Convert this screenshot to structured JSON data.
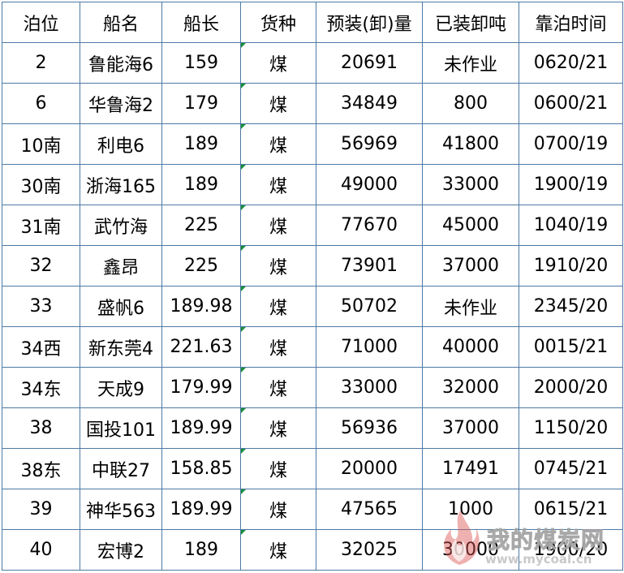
{
  "headers": [
    "泊位",
    "船名",
    "船长",
    "货种",
    "预装(卸)量",
    "已装卸吨",
    "靠泊时间"
  ],
  "rows": [
    [
      "2",
      "鲁能海6",
      "159",
      "煤",
      "20691",
      "未作业",
      "0620/21"
    ],
    [
      "6",
      "华鲁海2",
      "179",
      "煤",
      "34849",
      "800",
      "0600/21"
    ],
    [
      "10南",
      "利电6",
      "189",
      "煤",
      "56969",
      "41800",
      "0700/19"
    ],
    [
      "30南",
      "浙海165",
      "189",
      "煤",
      "49000",
      "33000",
      "1900/19"
    ],
    [
      "31南",
      "武竹海",
      "225",
      "煤",
      "77670",
      "45000",
      "1040/19"
    ],
    [
      "32",
      "鑫昂",
      "225",
      "煤",
      "73901",
      "37000",
      "1910/20"
    ],
    [
      "33",
      "盛帆6",
      "189.98",
      "煤",
      "50702",
      "未作业",
      "2345/20"
    ],
    [
      "34西",
      "新东莞4",
      "221.63",
      "煤",
      "71000",
      "40000",
      "0015/21"
    ],
    [
      "34东",
      "天成9",
      "179.99",
      "煤",
      "33000",
      "32000",
      "2000/20"
    ],
    [
      "38",
      "国投101",
      "189.99",
      "煤",
      "56936",
      "37000",
      "1150/20"
    ],
    [
      "38东",
      "中联27",
      "158.85",
      "煤",
      "20000",
      "17491",
      "0745/21"
    ],
    [
      "39",
      "神华563",
      "189.99",
      "煤",
      "47565",
      "1000",
      "0615/21"
    ],
    [
      "40",
      "宏博2",
      "189",
      "煤",
      "32025",
      "30000",
      "1900/20"
    ]
  ],
  "watermark": {
    "brand": "我的煤炭网",
    "url": "www.mycoal.cn",
    "icon": "flame-logo-icon"
  },
  "colors": {
    "grid": "#4d7aa6",
    "cell_marker": "#1a8f3a",
    "watermark_flame": "#d9534f"
  }
}
